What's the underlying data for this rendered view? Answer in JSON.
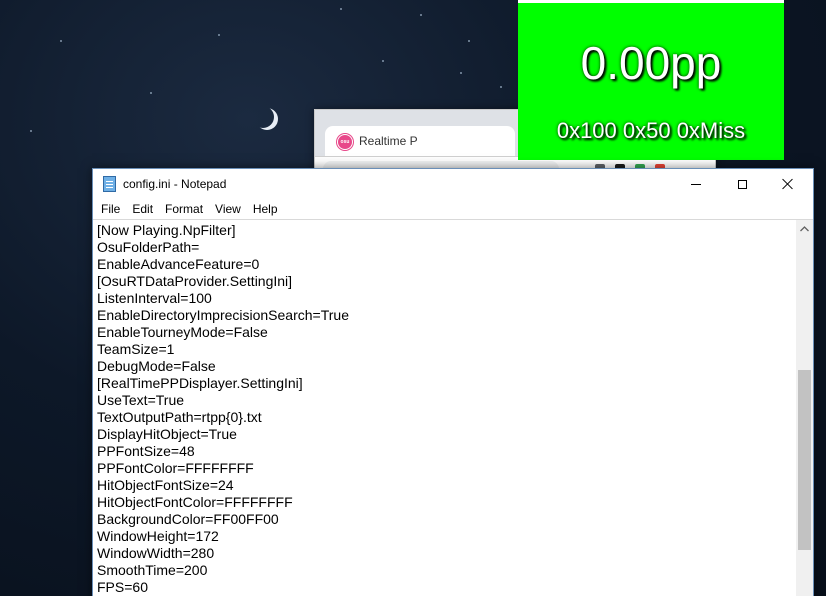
{
  "browser": {
    "tab_title": "Realtime P",
    "tab_icon_label": "osu",
    "favicon_icon": "osu-logo-icon",
    "extension_colors": [
      "#5f6368",
      "#1a1a1a",
      "#34a853",
      "#ea4335"
    ]
  },
  "pp_overlay": {
    "pp_value": "0.00pp",
    "hit_counts": "0x100 0x50 0xMiss",
    "background_color": "#00ff00",
    "text_color": "#ffffff"
  },
  "notepad": {
    "title": "config.ini - Notepad",
    "app_icon": "notepad-icon",
    "window_controls": {
      "minimize_icon": "minimize-icon",
      "maximize_icon": "maximize-icon",
      "close_icon": "close-icon"
    },
    "menu": [
      "File",
      "Edit",
      "Format",
      "View",
      "Help"
    ],
    "lines": [
      "[Now Playing.NpFilter]",
      "OsuFolderPath=",
      "EnableAdvanceFeature=0",
      "[OsuRTDataProvider.SettingIni]",
      "ListenInterval=100",
      "EnableDirectoryImprecisionSearch=True",
      "EnableTourneyMode=False",
      "TeamSize=1",
      "DebugMode=False",
      "[RealTimePPDisplayer.SettingIni]",
      "UseText=True",
      "TextOutputPath=rtpp{0}.txt",
      "DisplayHitObject=True",
      "PPFontSize=48",
      "PPFontColor=FFFFFFFF",
      "HitObjectFontSize=24",
      "HitObjectFontColor=FFFFFFFF",
      "BackgroundColor=FF00FF00",
      "WindowHeight=172",
      "WindowWidth=280",
      "SmoothTime=200",
      "FPS=60"
    ],
    "scrollbar": {
      "up_icon": "scroll-up-arrow-icon"
    }
  }
}
